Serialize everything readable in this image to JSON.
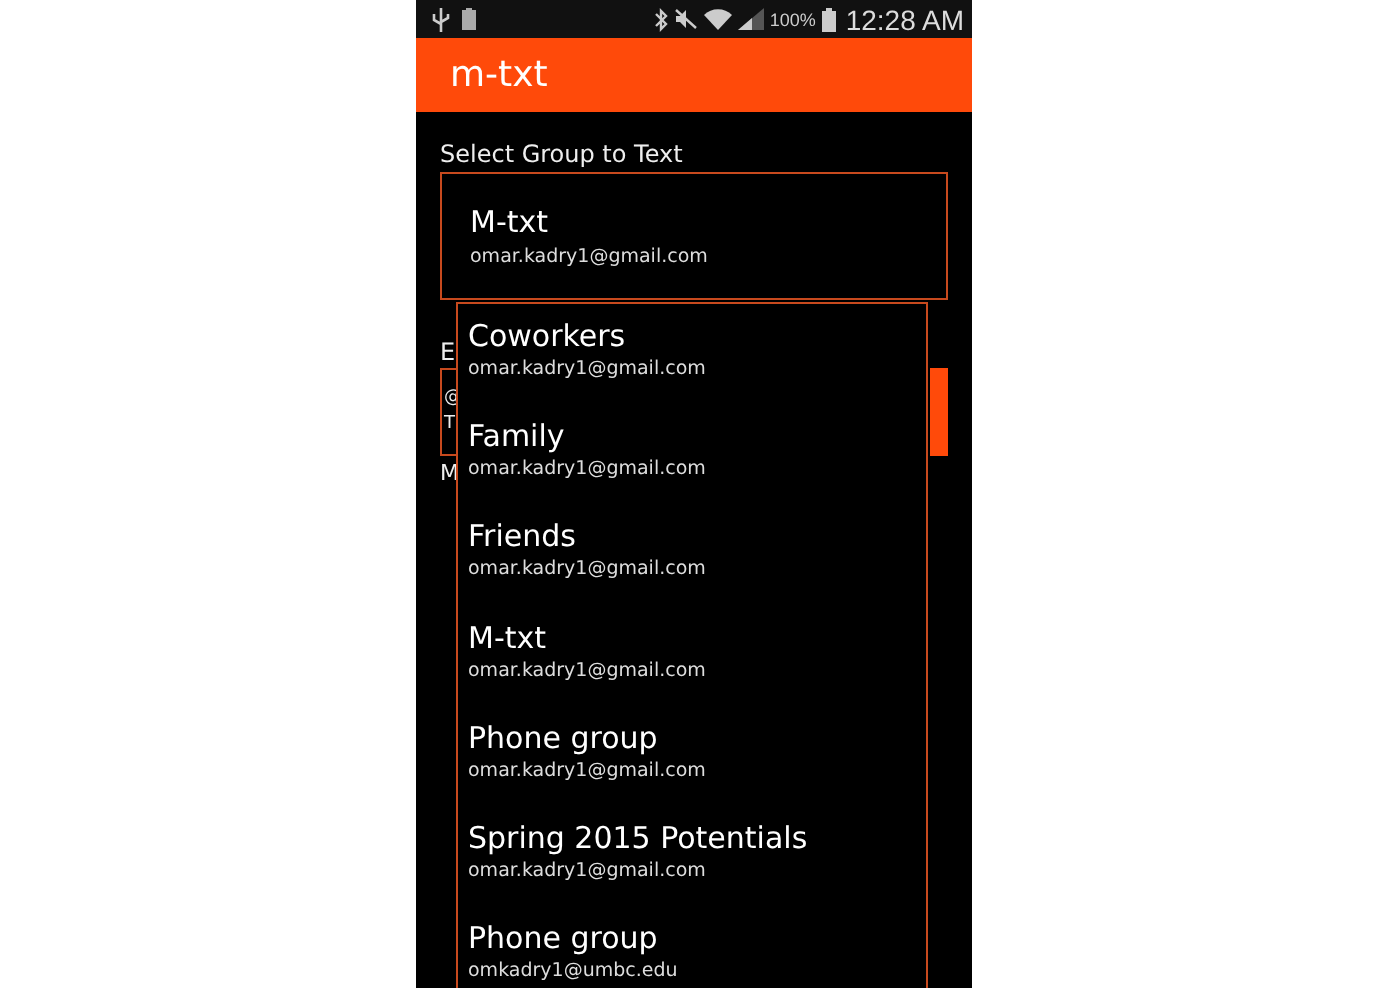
{
  "status_bar": {
    "battery_text": "100%",
    "time": "12:28 AM"
  },
  "app_bar": {
    "title": "m-txt"
  },
  "form": {
    "group_label": "Select Group to Text",
    "selected_group": {
      "name": "M-txt",
      "email": "omar.kadry1@gmail.com"
    },
    "hidden_label": "E",
    "hidden_field_lines": [
      "@",
      "T"
    ],
    "hidden_note": "M"
  },
  "dropdown": {
    "items": [
      {
        "name": "Coworkers",
        "email": "omar.kadry1@gmail.com"
      },
      {
        "name": "Family",
        "email": "omar.kadry1@gmail.com"
      },
      {
        "name": "Friends",
        "email": "omar.kadry1@gmail.com"
      },
      {
        "name": "M-txt",
        "email": "omar.kadry1@gmail.com"
      },
      {
        "name": "Phone group",
        "email": "omar.kadry1@gmail.com"
      },
      {
        "name": "Spring 2015 Potentials",
        "email": "omar.kadry1@gmail.com"
      },
      {
        "name": "Phone group",
        "email": "omkadry1@umbc.edu"
      }
    ]
  }
}
